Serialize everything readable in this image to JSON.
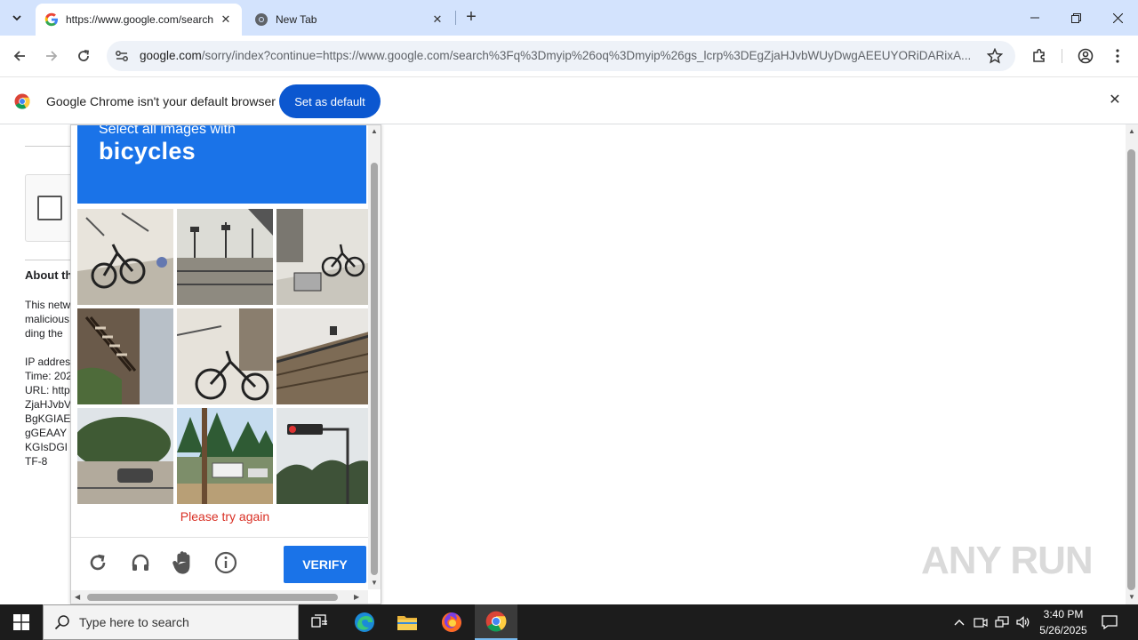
{
  "browser": {
    "tabs": [
      {
        "title": "https://www.google.com/search",
        "active": true
      },
      {
        "title": "New Tab",
        "active": false
      }
    ],
    "url": {
      "host": "google.com",
      "rest": "/sorry/index?continue=https://www.google.com/search%3Fq%3Dmyip%26oq%3Dmyip%26gs_lcrp%3DEgZjaHJvbWUyDwgAEEUYORiDARixA..."
    }
  },
  "infobar": {
    "message": "Google Chrome isn't your default browser",
    "button": "Set as default"
  },
  "background_page": {
    "heading": "About th",
    "lines1": [
      "This netw",
      "malicious",
      "ding the"
    ],
    "lines2": [
      "IP addres",
      "Time: 202",
      "URL: http",
      "ZjaHJvbV",
      "BgKGIAE",
      "gGEAAY",
      "KGIsDGI",
      "TF-8"
    ]
  },
  "captcha": {
    "instruction": "Select all images with",
    "target": "bicycles",
    "error": "Please try again",
    "verify": "VERIFY"
  },
  "watermark": "ANY RUN",
  "taskbar": {
    "search_placeholder": "Type here to search",
    "time": "3:40 PM",
    "date": "5/26/2025"
  },
  "colors": {
    "captcha_blue": "#1a73e8",
    "chrome_blue": "#0b57d0",
    "tabstrip": "#d3e3fd",
    "error_red": "#d93025"
  }
}
